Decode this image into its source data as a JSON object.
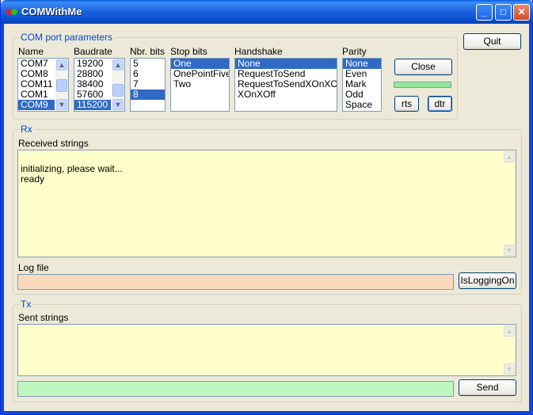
{
  "window": {
    "title": "COMWithMe"
  },
  "titlebar": {
    "minimize": "_",
    "maximize": "□",
    "close": "✕"
  },
  "com_params": {
    "legend": "COM port parameters",
    "name_label": "Name",
    "names": [
      "COM7",
      "COM8",
      "COM11",
      "COM1",
      "COM9"
    ],
    "name_selected": "COM9",
    "baud_label": "Baudrate",
    "bauds": [
      "19200",
      "28800",
      "38400",
      "57600",
      "115200"
    ],
    "baud_selected": "115200",
    "bits_label": "Nbr. bits",
    "bits": [
      "5",
      "6",
      "7",
      "8"
    ],
    "bits_selected": "8",
    "stop_label": "Stop bits",
    "stops": [
      "One",
      "OnePointFive",
      "Two"
    ],
    "stop_selected": "One",
    "handshake_label": "Handshake",
    "handshakes": [
      "None",
      "RequestToSend",
      "RequestToSendXOnXOff",
      "XOnXOff"
    ],
    "handshake_selected": "None",
    "parity_label": "Parity",
    "parities": [
      "None",
      "Even",
      "Mark",
      "Odd",
      "Space"
    ],
    "parity_selected": "None",
    "close_label": "Close",
    "rts_label": "rts",
    "dtr_label": "dtr",
    "status_color": "#90E890"
  },
  "quit_label": "Quit",
  "rx": {
    "legend": "Rx",
    "received_label": "Received strings",
    "received_lines": "initializing, please wait...\nready",
    "logfile_label": "Log file",
    "logfile_value": "",
    "logging_button": "IsLoggingOn",
    "logfile_color": "#FAD9BC"
  },
  "tx": {
    "legend": "Tx",
    "sent_label": "Sent strings",
    "sent_text": "",
    "input_value": "",
    "send_button": "Send",
    "input_color": "#BFF7BF"
  },
  "colors": {
    "textarea_bg": "#FFFFCC",
    "selection": "#316AC5",
    "legend": "#0046D5"
  }
}
